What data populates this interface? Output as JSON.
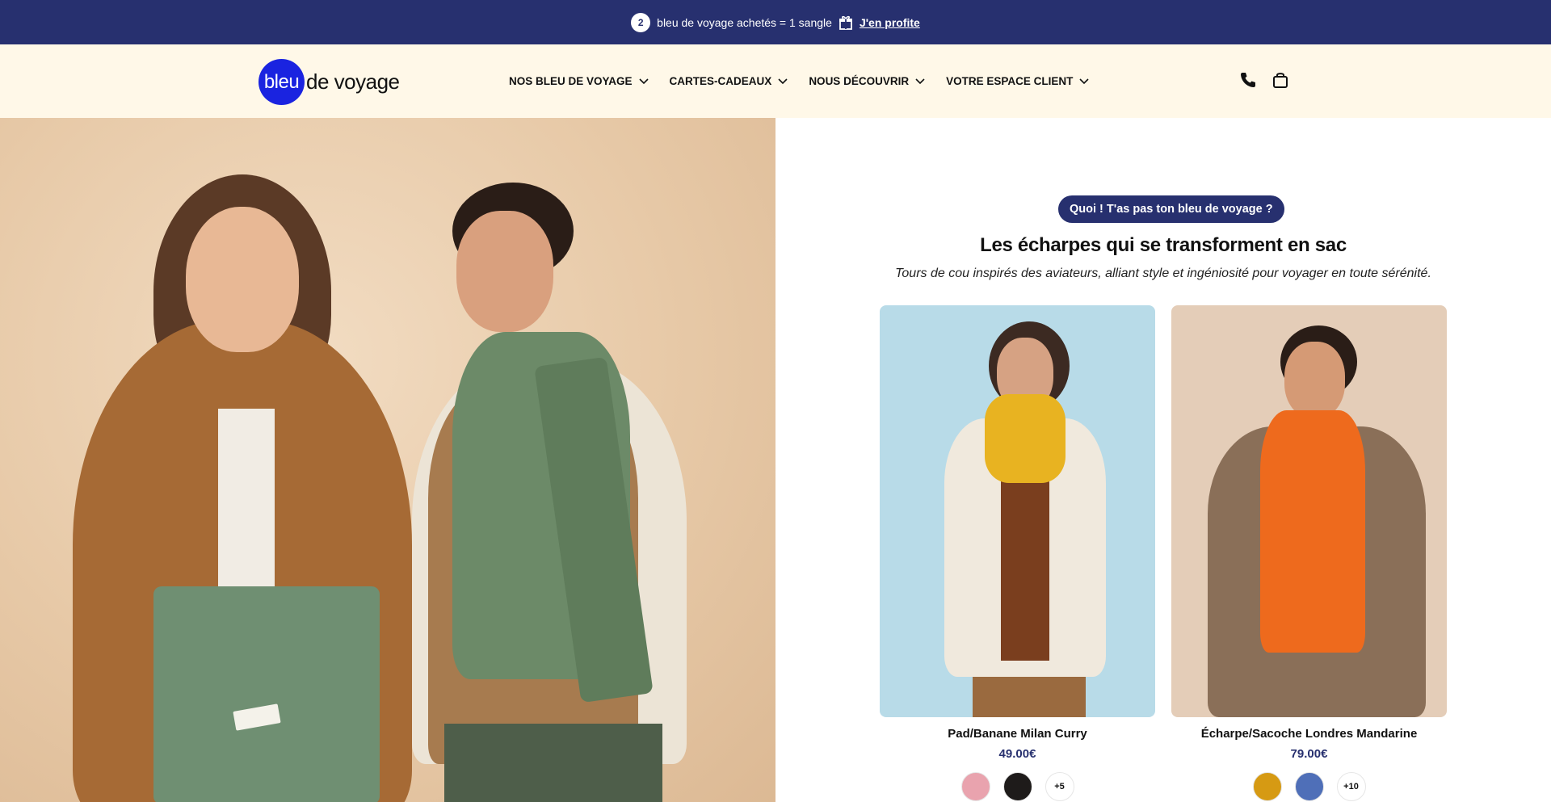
{
  "promo": {
    "count": "2",
    "text": "bleu de voyage achetés = 1 sangle",
    "link": "J'en profite",
    "gift_icon": "gift-icon"
  },
  "header": {
    "logo_circle": "bleu",
    "logo_text": "de voyage",
    "nav": [
      {
        "label": "NOS BLEU DE VOYAGE"
      },
      {
        "label": "CARTES-CADEAUX"
      },
      {
        "label": "NOUS DÉCOUVRIR"
      },
      {
        "label": "VOTRE ESPACE CLIENT"
      }
    ],
    "icons": [
      "phone-icon",
      "cart-icon"
    ]
  },
  "hero": {
    "image": "scarves-campaign-photo"
  },
  "content": {
    "pill": "Quoi ! T'as pas ton bleu de voyage ?",
    "headline": "Les écharpes qui se transforment en sac",
    "subline": "Tours de cou inspirés des aviateurs, alliant style et ingéniosité pour voyager en toute sérénité.",
    "products": [
      {
        "title": "Pad/Banane Milan Curry",
        "price": "49.00€",
        "swatches": [
          "#e9a3ae",
          "#1e1b1a"
        ],
        "more": "+5"
      },
      {
        "title": "Écharpe/Sacoche Londres Mandarine",
        "price": "79.00€",
        "swatches": [
          "#d69a13",
          "#4f6fb8"
        ],
        "more": "+10"
      }
    ]
  },
  "colors": {
    "brand_navy": "#27306f",
    "logo_blue": "#1a23e0",
    "header_bg": "#fff8e8"
  }
}
